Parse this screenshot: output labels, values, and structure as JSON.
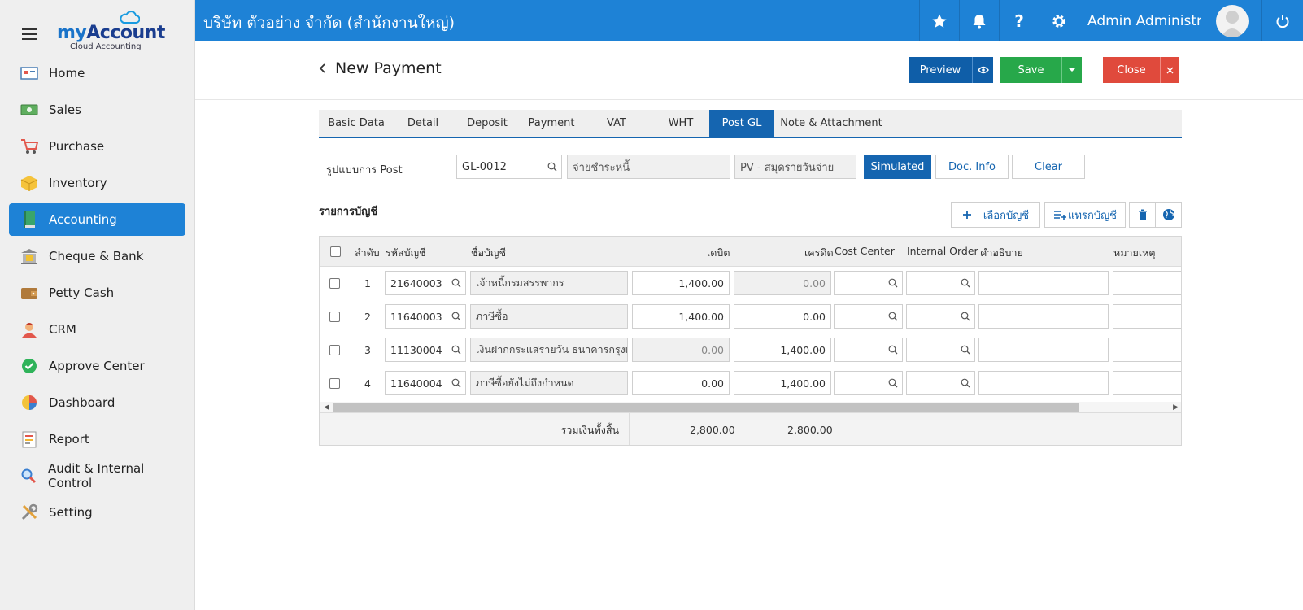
{
  "app": {
    "logo_my": "my",
    "logo_account": "Account",
    "logo_sub": "Cloud Accounting",
    "company": "บริษัท ตัวอย่าง จำกัด (สำนักงานใหญ่)",
    "user_name": "Admin Administr...",
    "accent_color": "#1e82d6"
  },
  "sidebar": {
    "items": [
      {
        "label": "Home",
        "icon": "home-icon"
      },
      {
        "label": "Sales",
        "icon": "money-icon"
      },
      {
        "label": "Purchase",
        "icon": "cart-icon"
      },
      {
        "label": "Inventory",
        "icon": "box-icon"
      },
      {
        "label": "Accounting",
        "icon": "ledger-book-icon",
        "active": true
      },
      {
        "label": "Cheque & Bank",
        "icon": "bank-icon"
      },
      {
        "label": "Petty Cash",
        "icon": "wallet-icon"
      },
      {
        "label": "CRM",
        "icon": "person-icon"
      },
      {
        "label": "Approve Center",
        "icon": "check-circle-icon"
      },
      {
        "label": "Dashboard",
        "icon": "pie-chart-icon"
      },
      {
        "label": "Report",
        "icon": "report-icon"
      },
      {
        "label": "Audit & Internal Control",
        "icon": "magnifier-icon"
      },
      {
        "label": "Setting",
        "icon": "tools-icon"
      }
    ]
  },
  "page": {
    "title": "New Payment",
    "buttons": {
      "preview": "Preview",
      "save": "Save",
      "close": "Close"
    }
  },
  "tabs": [
    {
      "label": "Basic Data"
    },
    {
      "label": "Detail"
    },
    {
      "label": "Deposit"
    },
    {
      "label": "Payment"
    },
    {
      "label": "VAT"
    },
    {
      "label": "WHT"
    },
    {
      "label": "Post GL",
      "active": true
    },
    {
      "label": "Note & Attachment"
    }
  ],
  "post": {
    "label": "รูปแบบการ Post",
    "code": "GL-0012",
    "name": "จ่ายชำระหนี้",
    "journal": "PV - สมุดรายวันจ่าย",
    "btn_simulated": "Simulated",
    "btn_docinfo": "Doc. Info",
    "btn_clear": "Clear"
  },
  "accounts": {
    "section_title": "รายการบัญชี",
    "btn_select": "เลือกบัญชี",
    "btn_insert": "แทรกบัญชี",
    "columns": {
      "no": "ลำดับ",
      "code": "รหัสบัญชี",
      "name": "ชื่อบัญชี",
      "debit": "เดบิต",
      "credit": "เครดิต",
      "cost_center": "Cost Center",
      "internal_order": "Internal Order",
      "description": "คำอธิบาย",
      "remark": "หมายเหตุ"
    },
    "rows": [
      {
        "no": "1",
        "code": "21640003",
        "name": "เจ้าหนี้กรมสรรพากร",
        "debit": "1,400.00",
        "credit": "0.00"
      },
      {
        "no": "2",
        "code": "11640003",
        "name": "ภาษีซื้อ",
        "debit": "1,400.00",
        "credit": "0.00"
      },
      {
        "no": "3",
        "code": "11130004",
        "name": "เงินฝากกระแสรายวัน ธนาคารกรุงเท",
        "debit": "0.00",
        "credit": "1,400.00"
      },
      {
        "no": "4",
        "code": "11640004",
        "name": "ภาษีซื้อยังไม่ถึงกำหนด",
        "debit": "0.00",
        "credit": "1,400.00"
      }
    ],
    "total_label": "รวมเงินทั้งสิ้น",
    "total_debit": "2,800.00",
    "total_credit": "2,800.00"
  }
}
